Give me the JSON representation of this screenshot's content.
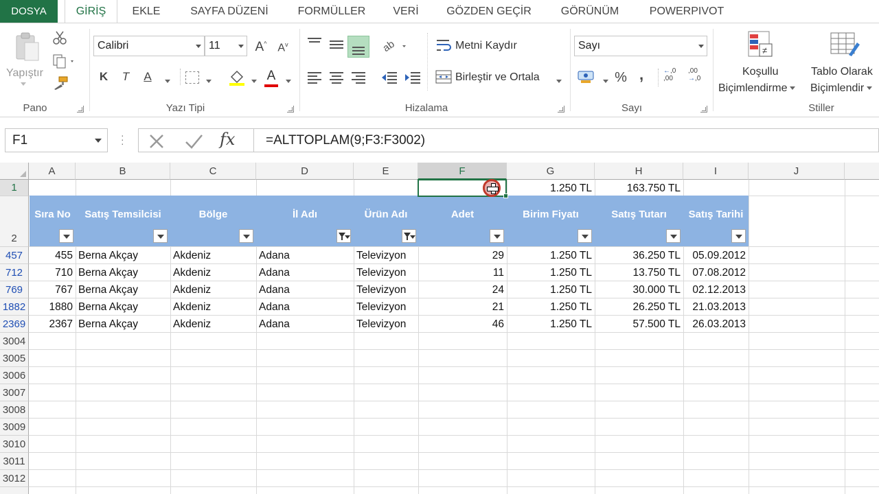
{
  "tabs": {
    "file": "DOSYA",
    "items": [
      "GİRİŞ",
      "EKLE",
      "SAYFA DÜZENİ",
      "FORMÜLLER",
      "VERİ",
      "GÖZDEN GEÇİR",
      "GÖRÜNÜM",
      "POWERPIVOT"
    ],
    "active": "GİRİŞ"
  },
  "ribbon": {
    "clipboard": {
      "paste": "Yapıştır",
      "label": "Pano"
    },
    "font": {
      "name": "Calibri",
      "size": "11",
      "bold": "K",
      "italic": "T",
      "underline": "A",
      "label": "Yazı Tipi"
    },
    "alignment": {
      "wrap": "Metni Kaydır",
      "merge": "Birleştir ve Ortala",
      "label": "Hizalama"
    },
    "number": {
      "format": "Sayı",
      "percent": "%",
      "comma": ",",
      "label": "Sayı"
    },
    "styles": {
      "conditional_line1": "Koşullu",
      "conditional_line2": "Biçimlendirme",
      "table_line1": "Tablo Olarak",
      "table_line2": "Biçimlendir",
      "label": "Stiller"
    }
  },
  "formula_bar": {
    "name_box": "F1",
    "formula": "=ALTTOPLAM(9;F3:F3002)",
    "fx": "fx"
  },
  "sheet": {
    "columns": [
      "A",
      "B",
      "C",
      "D",
      "E",
      "F",
      "G",
      "H",
      "I",
      "J"
    ],
    "selected_column": "F",
    "row1": {
      "G": "1.250 TL",
      "H": "163.750 TL"
    },
    "headers": [
      "Sıra No",
      "Satış Temsilcisi",
      "Bölge",
      "İl Adı",
      "Ürün Adı",
      "Adet",
      "Birim Fiyatı",
      "Satış Tutarı",
      "Satış Tarihi"
    ],
    "filtered_columns": [
      "İl Adı",
      "Ürün Adı"
    ],
    "row_numbers": [
      "1",
      "2",
      "457",
      "712",
      "769",
      "1882",
      "2369",
      "3004",
      "3005",
      "3006",
      "3007",
      "3008",
      "3009",
      "3010",
      "3011",
      "3012"
    ],
    "rows": [
      [
        "455",
        "Berna Akçay",
        "Akdeniz",
        "Adana",
        "Televizyon",
        "29",
        "1.250 TL",
        "36.250 TL",
        "05.09.2012"
      ],
      [
        "710",
        "Berna Akçay",
        "Akdeniz",
        "Adana",
        "Televizyon",
        "11",
        "1.250 TL",
        "13.750 TL",
        "07.08.2012"
      ],
      [
        "767",
        "Berna Akçay",
        "Akdeniz",
        "Adana",
        "Televizyon",
        "24",
        "1.250 TL",
        "30.000 TL",
        "02.12.2013"
      ],
      [
        "1880",
        "Berna Akçay",
        "Akdeniz",
        "Adana",
        "Televizyon",
        "21",
        "1.250 TL",
        "26.250 TL",
        "21.03.2013"
      ],
      [
        "2367",
        "Berna Akçay",
        "Akdeniz",
        "Adana",
        "Televizyon",
        "46",
        "1.250 TL",
        "57.500 TL",
        "26.03.2013"
      ]
    ]
  },
  "colors": {
    "accent": "#217346",
    "header_band": "#8db3e2",
    "filtered_row_number": "#1f4eb4"
  }
}
